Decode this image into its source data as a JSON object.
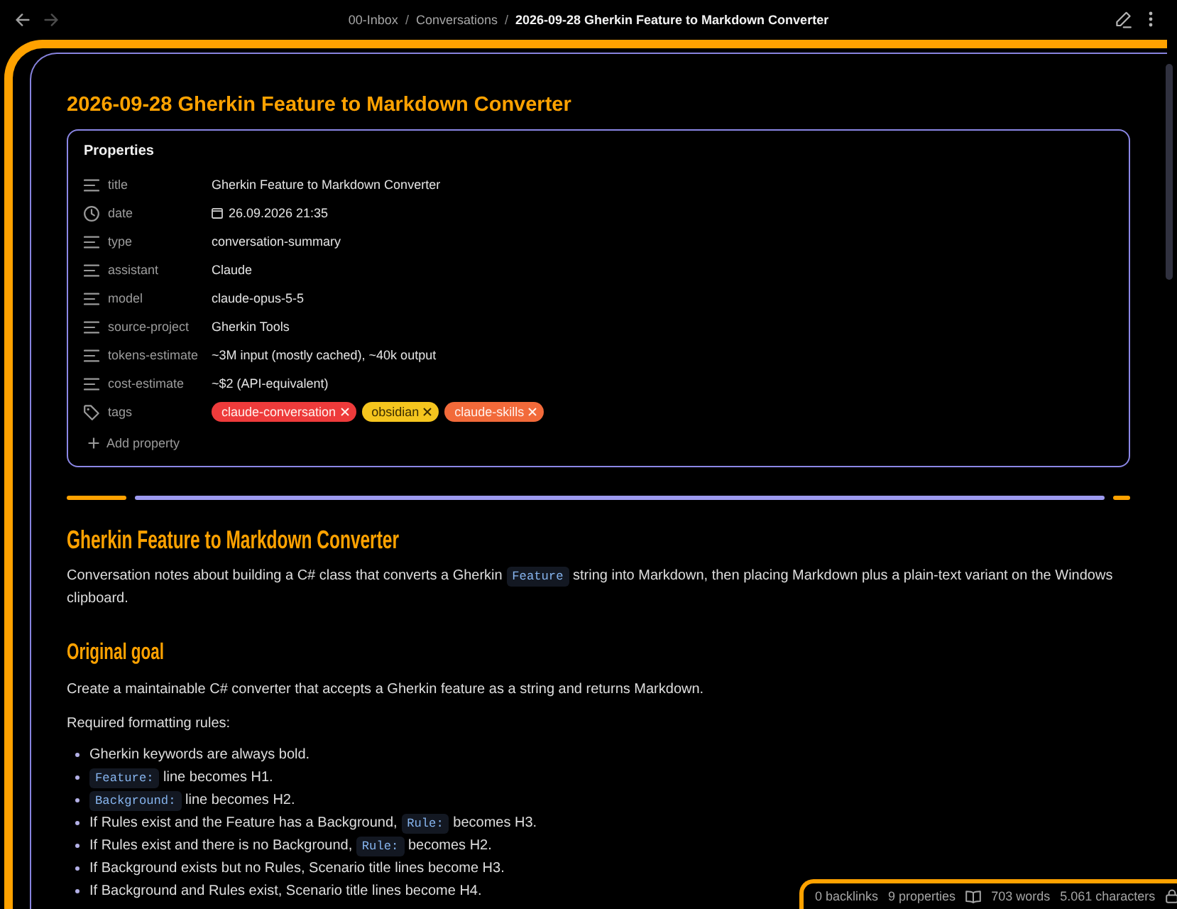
{
  "top_bar": {
    "nav": [
      {
        "kind": "back",
        "disabled": false
      },
      {
        "kind": "forward",
        "disabled": true
      }
    ],
    "breadcrumb": [
      {
        "label": "00-Inbox",
        "current": false,
        "separator": "/"
      },
      {
        "label": "Conversations",
        "current": false,
        "separator": "/"
      },
      {
        "label": "2026-09-28 Gherkin Feature to Markdown Converter",
        "current": true
      }
    ],
    "actions": [
      {
        "kind": "edit"
      },
      {
        "kind": "more"
      }
    ]
  },
  "note": {
    "title": "2026-09-28 Gherkin Feature to Markdown Converter",
    "properties": {
      "heading": "Properties",
      "items": [
        {
          "kind": "text",
          "key": "title",
          "value": "Gherkin Feature to Markdown Converter"
        },
        {
          "kind": "datetime",
          "key": "date",
          "value": "26.09.2026 21:35"
        },
        {
          "kind": "text",
          "key": "type",
          "value": "conversation-summary"
        },
        {
          "kind": "text",
          "key": "assistant",
          "value": "Claude"
        },
        {
          "kind": "text",
          "key": "model",
          "value": "claude-opus-5-5"
        },
        {
          "kind": "text",
          "key": "source-project",
          "value": "Gherkin Tools"
        },
        {
          "kind": "text",
          "key": "tokens-estimate",
          "value": "~3M input (mostly cached), ~40k output"
        },
        {
          "kind": "text",
          "key": "cost-estimate",
          "value": "~$2 (API-equivalent)"
        },
        {
          "kind": "tags",
          "key": "tags",
          "tags": [
            {
              "label": "claude-conversation",
              "color": "#ee3b3b"
            },
            {
              "label": "obsidian",
              "color": "#f5c51e"
            },
            {
              "label": "claude-skills",
              "color": "#f26a3a"
            }
          ]
        }
      ],
      "add_label": "Add property"
    },
    "body": [
      {
        "kind": "h1",
        "text": "Gherkin Feature to Markdown Converter"
      },
      {
        "kind": "p",
        "parts": [
          {
            "kind": "text",
            "text": "Conversation notes about building a C# class that converts a Gherkin "
          },
          {
            "kind": "code",
            "text": "Feature"
          },
          {
            "kind": "text",
            "text": " string into Markdown, then placing Markdown plus a plain-text variant on the Windows clipboard."
          }
        ]
      },
      {
        "kind": "h2",
        "text": "Original goal"
      },
      {
        "kind": "p",
        "parts": [
          {
            "kind": "text",
            "text": "Create a maintainable C# converter that accepts a Gherkin feature as a string and returns Markdown."
          }
        ]
      },
      {
        "kind": "p",
        "parts": [
          {
            "kind": "text",
            "text": "Required formatting rules:"
          }
        ]
      },
      {
        "kind": "list",
        "items": [
          {
            "parts": [
              {
                "kind": "text",
                "text": "Gherkin keywords are always bold."
              }
            ]
          },
          {
            "parts": [
              {
                "kind": "code",
                "text": "Feature:"
              },
              {
                "kind": "text",
                "text": " line becomes H1."
              }
            ]
          },
          {
            "parts": [
              {
                "kind": "code",
                "text": "Background:"
              },
              {
                "kind": "text",
                "text": " line becomes H2."
              }
            ]
          },
          {
            "parts": [
              {
                "kind": "text",
                "text": "If Rules exist and the Feature has a Background, "
              },
              {
                "kind": "code",
                "text": "Rule:"
              },
              {
                "kind": "text",
                "text": " becomes H3."
              }
            ]
          },
          {
            "parts": [
              {
                "kind": "text",
                "text": "If Rules exist and there is no Background, "
              },
              {
                "kind": "code",
                "text": "Rule:"
              },
              {
                "kind": "text",
                "text": " becomes H2."
              }
            ]
          },
          {
            "parts": [
              {
                "kind": "text",
                "text": "If Background exists but no Rules, Scenario title lines become H3."
              }
            ]
          },
          {
            "parts": [
              {
                "kind": "text",
                "text": "If Background and Rules exist, Scenario title lines become H4."
              }
            ]
          }
        ]
      }
    ]
  },
  "status_bar": {
    "items": [
      {
        "kind": "label",
        "text": "0 backlinks"
      },
      {
        "kind": "label",
        "text": "9 properties"
      },
      {
        "kind": "reading"
      },
      {
        "kind": "label",
        "text": "703 words"
      },
      {
        "kind": "label",
        "text": "5.061 characters"
      },
      {
        "kind": "lock"
      }
    ]
  }
}
